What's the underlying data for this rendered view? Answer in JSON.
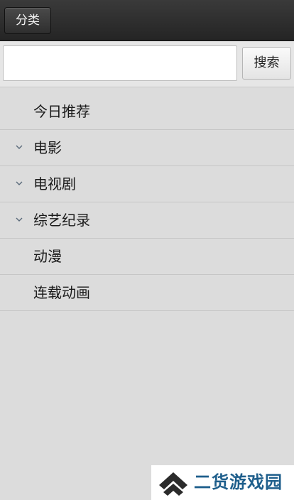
{
  "topbar": {
    "category_label": "分类"
  },
  "search": {
    "value": "",
    "placeholder": "",
    "button_label": "搜索"
  },
  "menu": {
    "items": [
      {
        "label": "今日推荐",
        "expandable": false
      },
      {
        "label": "电影",
        "expandable": true
      },
      {
        "label": "电视剧",
        "expandable": true
      },
      {
        "label": "综艺纪录",
        "expandable": true
      },
      {
        "label": "动漫",
        "expandable": false
      },
      {
        "label": "连载动画",
        "expandable": false
      }
    ],
    "chevron_icon": "chevron-down-icon"
  },
  "watermark": {
    "logo_icon": "double-chevron-up-logo",
    "text": "二货游戏园",
    "color": "#1f5f8c"
  }
}
